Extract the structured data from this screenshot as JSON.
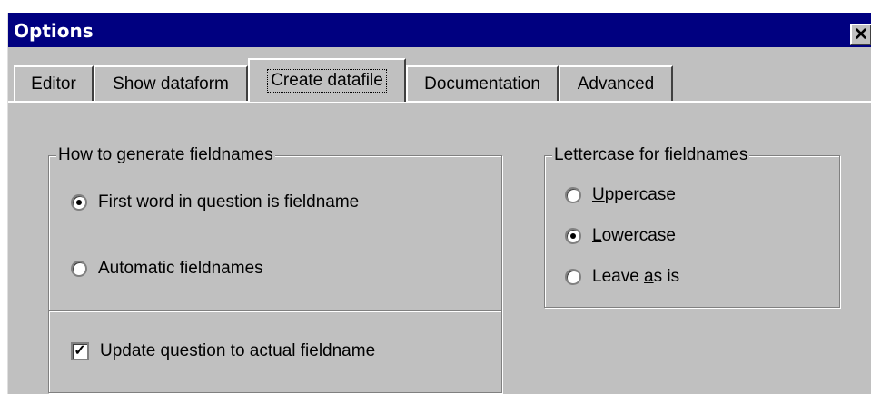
{
  "window": {
    "title": "Options",
    "close_glyph": "✕"
  },
  "tabs": [
    {
      "label": "Editor",
      "active": false
    },
    {
      "label": "Show dataform",
      "active": false
    },
    {
      "label": "Create datafile",
      "active": true
    },
    {
      "label": "Documentation",
      "active": false
    },
    {
      "label": "Advanced",
      "active": false
    }
  ],
  "fieldnames_group": {
    "legend": "How to generate fieldnames",
    "options": [
      {
        "label": "First word in question is fieldname",
        "selected": true
      },
      {
        "label": "Automatic fieldnames",
        "selected": false
      }
    ],
    "update_checkbox": {
      "label": "Update question to actual fieldname",
      "checked": true,
      "glyph": "✓"
    }
  },
  "lettercase_group": {
    "legend": "Lettercase for fieldnames",
    "options": [
      {
        "label_pre": "",
        "accel": "U",
        "label_post": "ppercase",
        "selected": false
      },
      {
        "label_pre": "",
        "accel": "L",
        "label_post": "owercase",
        "selected": true
      },
      {
        "label_pre": "Leave ",
        "accel": "a",
        "label_post": "s is",
        "selected": false
      }
    ]
  }
}
